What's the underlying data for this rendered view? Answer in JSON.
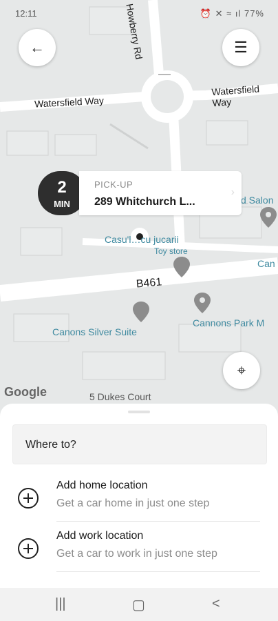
{
  "status": {
    "time": "12:11",
    "battery": "77%",
    "icons": "⏰ ✕ ≈ ıl"
  },
  "map": {
    "roads": [
      "Howberry Rd",
      "Watersfield Way",
      "Watersfield Way",
      "B461"
    ],
    "pois": [
      "Casu'l…cu jucarii",
      "Toy store",
      "Canons Silver Suite",
      "Cannons Park M",
      "d Salon",
      "Can",
      "5 Dukes Court"
    ],
    "attribution": "Google"
  },
  "header": {
    "back_icon": "arrow-left-icon",
    "menu_icon": "hamburger-menu-icon"
  },
  "pickup": {
    "eta_value": "2",
    "eta_unit": "MIN",
    "caption": "PICK-UP",
    "address": "289 Whitchurch L...",
    "chevron": "›"
  },
  "sheet": {
    "where_to": "Where to?",
    "items": [
      {
        "title": "Add home location",
        "subtitle": "Get a car home in just one step"
      },
      {
        "title": "Add work location",
        "subtitle": "Get a car to work in just one step"
      }
    ]
  },
  "navbar": {
    "recent": "|||",
    "home": "▢",
    "back": "<"
  }
}
